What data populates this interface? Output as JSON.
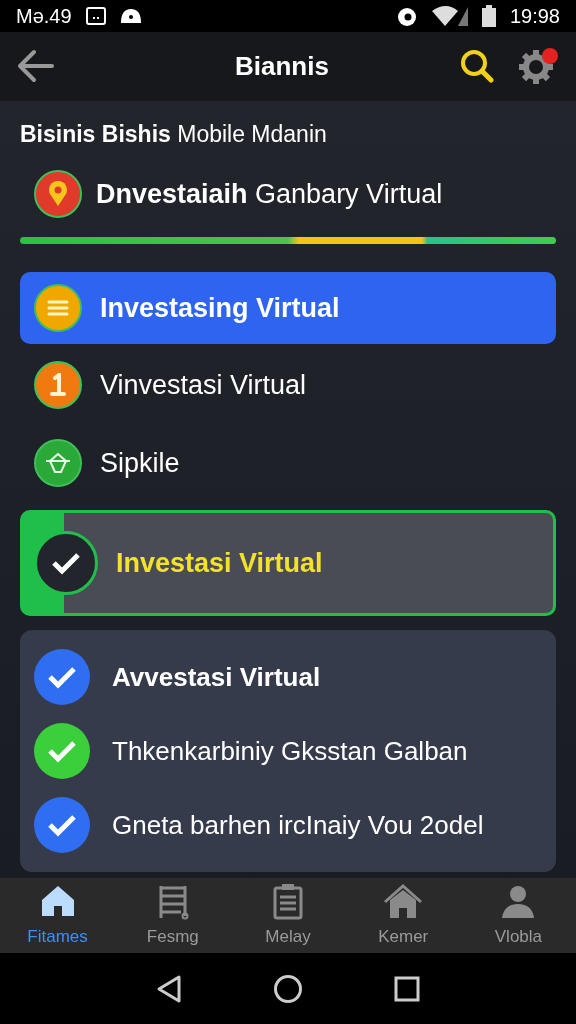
{
  "status_bar": {
    "time_left": "Mə.49",
    "time_right": "19:98"
  },
  "header": {
    "title": "Biannis",
    "notification": true
  },
  "section": {
    "heading": "**Bisinis Bishis** Mobile Mdanin"
  },
  "featured": {
    "label": "**Dnvestaiaih** Ganbary Virtual",
    "color": "#e03a2a"
  },
  "menu": [
    {
      "label": "Investasing Virtual",
      "kind": "icon",
      "selected": true,
      "color": "#f0a800"
    },
    {
      "label": "Vinvestasi Virtual",
      "kind": "icon",
      "selected": false,
      "color": "#f07a10"
    },
    {
      "label": "Sipkile",
      "kind": "icon",
      "selected": false,
      "color": "#2aa838"
    },
    {
      "label": "Investasi Virtual",
      "kind": "done",
      "selected": false,
      "color": "#1fbf4a"
    }
  ],
  "checklist": [
    {
      "label": "Avvestasi Virtual",
      "checked": true,
      "color": "#2f6ef0"
    },
    {
      "label": "Thkenkarbiniy Gksstan Galban",
      "checked": true,
      "color": "#3bcf3b"
    },
    {
      "label": "Gneta barhen ircInaiy Vou 2odel",
      "checked": true,
      "color": "#2f6ef0"
    }
  ],
  "bottom_nav": [
    {
      "label": "Fitames",
      "selected": true
    },
    {
      "label": "Fesmg",
      "selected": false
    },
    {
      "label": "Melay",
      "selected": false
    },
    {
      "label": "Kemer",
      "selected": false
    },
    {
      "label": "Vlobla",
      "selected": false
    }
  ]
}
